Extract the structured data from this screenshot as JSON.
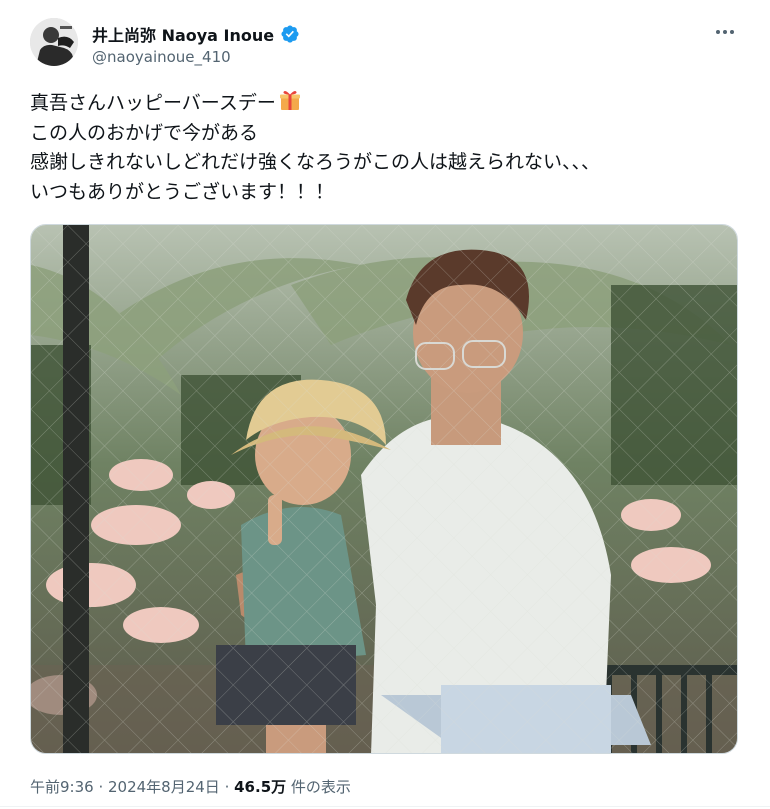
{
  "author": {
    "display_name": "井上尚弥 Naoya Inoue",
    "handle": "@naoyainoue_410",
    "verified": true,
    "avatar_icon": "avatar-image"
  },
  "more_icon": "more-options-icon",
  "tweet": {
    "lines": [
      "真吾さんハッピーバースデー",
      "この人のおかげで今がある",
      "感謝しきれないしどれだけ強くなろうがこの人は越えられない、、、",
      "いつもありがとうございます！！！"
    ],
    "emoji_icon": "gift-icon"
  },
  "media": {
    "icon": "photo-image"
  },
  "meta": {
    "time": "午前9:36",
    "sep1": " · ",
    "date": "2024年8月24日",
    "sep2": " · ",
    "views_count": "46.5万",
    "views_label": " 件の表示"
  },
  "colors": {
    "verified_blue": "#1d9bf0",
    "secondary_text": "#536471",
    "primary_text": "#0f1419"
  }
}
